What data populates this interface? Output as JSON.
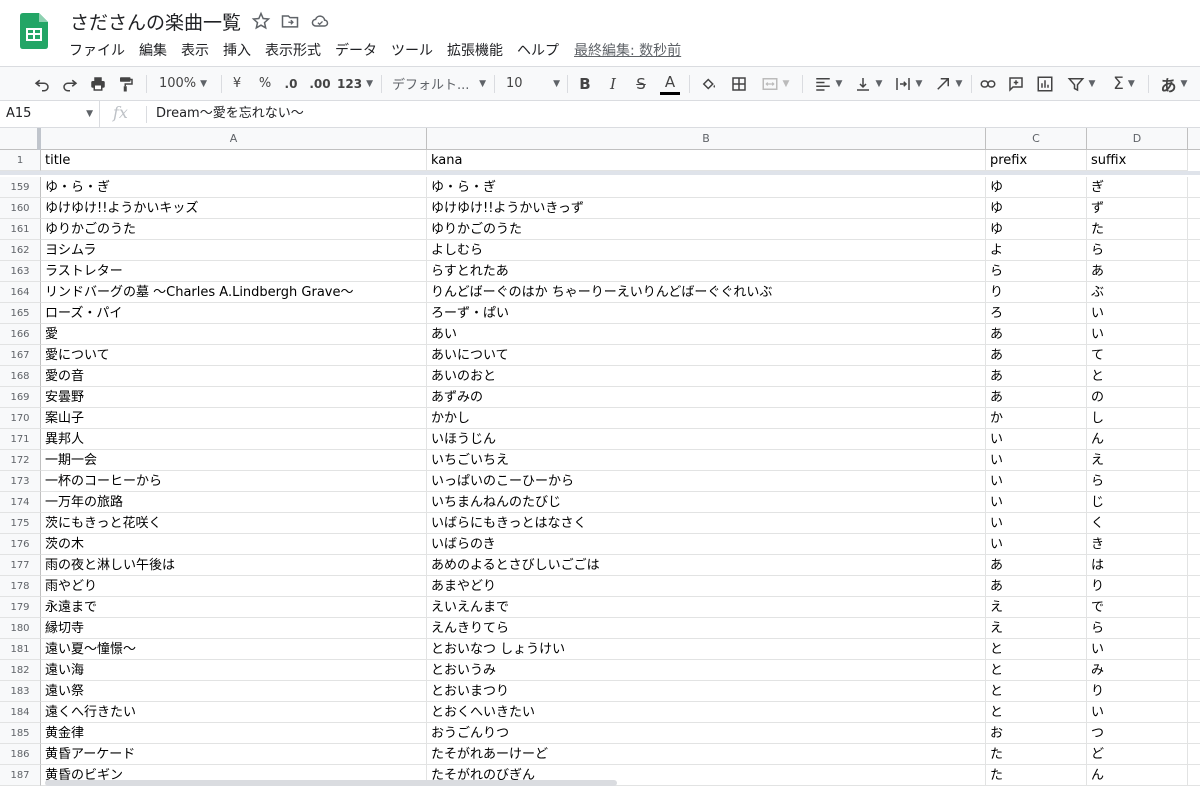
{
  "app": {
    "title": "さださんの楽曲一覧",
    "menu": [
      "ファイル",
      "編集",
      "表示",
      "挿入",
      "表示形式",
      "データ",
      "ツール",
      "拡張機能",
      "ヘルプ"
    ],
    "last_edit": "最終編集: 数秒前"
  },
  "toolbar": {
    "zoom": "100%",
    "currency": "¥",
    "percent": "%",
    "decrease_decimal": ".0",
    "increase_decimal": ".00",
    "number_format": "123",
    "font": "デフォルト...",
    "font_size": "10",
    "bold": "B",
    "italic": "I",
    "strike": "S",
    "text_color": "A",
    "input_tools": "あ"
  },
  "formula_bar": {
    "cell_ref": "A15",
    "fx": "fx",
    "value": "Dream〜愛を忘れない〜"
  },
  "columns": [
    {
      "letter": "A",
      "header": "title"
    },
    {
      "letter": "B",
      "header": "kana"
    },
    {
      "letter": "C",
      "header": "prefix"
    },
    {
      "letter": "D",
      "header": "suffix"
    }
  ],
  "header_row_number": "1",
  "rows": [
    {
      "n": "159",
      "title": "ゆ・ら・ぎ",
      "kana": "ゆ・ら・ぎ",
      "prefix": "ゆ",
      "suffix": "ぎ"
    },
    {
      "n": "160",
      "title": "ゆけゆけ!!ようかいキッズ",
      "kana": "ゆけゆけ!!ようかいきっず",
      "prefix": "ゆ",
      "suffix": "ず"
    },
    {
      "n": "161",
      "title": "ゆりかごのうた",
      "kana": "ゆりかごのうた",
      "prefix": "ゆ",
      "suffix": "た"
    },
    {
      "n": "162",
      "title": "ヨシムラ",
      "kana": "よしむら",
      "prefix": "よ",
      "suffix": "ら"
    },
    {
      "n": "163",
      "title": "ラストレター",
      "kana": "らすとれたあ",
      "prefix": "ら",
      "suffix": "あ"
    },
    {
      "n": "164",
      "title": "リンドバーグの墓 〜Charles A.Lindbergh Grave〜",
      "kana": "りんどばーぐのはか ちゃーりーえいりんどばーぐぐれいぶ",
      "prefix": "り",
      "suffix": "ぶ"
    },
    {
      "n": "165",
      "title": "ローズ・パイ",
      "kana": "ろーず・ぱい",
      "prefix": "ろ",
      "suffix": "い"
    },
    {
      "n": "166",
      "title": "愛",
      "kana": "あい",
      "prefix": "あ",
      "suffix": "い"
    },
    {
      "n": "167",
      "title": "愛について",
      "kana": "あいについて",
      "prefix": "あ",
      "suffix": "て"
    },
    {
      "n": "168",
      "title": "愛の音",
      "kana": "あいのおと",
      "prefix": "あ",
      "suffix": "と"
    },
    {
      "n": "169",
      "title": "安曇野",
      "kana": "あずみの",
      "prefix": "あ",
      "suffix": "の"
    },
    {
      "n": "170",
      "title": "案山子",
      "kana": "かかし",
      "prefix": "か",
      "suffix": "し"
    },
    {
      "n": "171",
      "title": "異邦人",
      "kana": "いほうじん",
      "prefix": "い",
      "suffix": "ん"
    },
    {
      "n": "172",
      "title": "一期一会",
      "kana": "いちごいちえ",
      "prefix": "い",
      "suffix": "え"
    },
    {
      "n": "173",
      "title": "一杯のコーヒーから",
      "kana": "いっぱいのこーひーから",
      "prefix": "い",
      "suffix": "ら"
    },
    {
      "n": "174",
      "title": "一万年の旅路",
      "kana": "いちまんねんのたびじ",
      "prefix": "い",
      "suffix": "じ"
    },
    {
      "n": "175",
      "title": "茨にもきっと花咲く",
      "kana": "いばらにもきっとはなさく",
      "prefix": "い",
      "suffix": "く"
    },
    {
      "n": "176",
      "title": "茨の木",
      "kana": "いばらのき",
      "prefix": "い",
      "suffix": "き"
    },
    {
      "n": "177",
      "title": "雨の夜と淋しい午後は",
      "kana": "あめのよるとさびしいごごは",
      "prefix": "あ",
      "suffix": "は"
    },
    {
      "n": "178",
      "title": "雨やどり",
      "kana": "あまやどり",
      "prefix": "あ",
      "suffix": "り"
    },
    {
      "n": "179",
      "title": "永遠まで",
      "kana": "えいえんまで",
      "prefix": "え",
      "suffix": "で"
    },
    {
      "n": "180",
      "title": "縁切寺",
      "kana": "えんきりてら",
      "prefix": "え",
      "suffix": "ら"
    },
    {
      "n": "181",
      "title": "遠い夏〜憧憬〜",
      "kana": "とおいなつ しょうけい",
      "prefix": "と",
      "suffix": "い"
    },
    {
      "n": "182",
      "title": "遠い海",
      "kana": "とおいうみ",
      "prefix": "と",
      "suffix": "み"
    },
    {
      "n": "183",
      "title": "遠い祭",
      "kana": "とおいまつり",
      "prefix": "と",
      "suffix": "り"
    },
    {
      "n": "184",
      "title": "遠くへ行きたい",
      "kana": "とおくへいきたい",
      "prefix": "と",
      "suffix": "い"
    },
    {
      "n": "185",
      "title": "黄金律",
      "kana": "おうごんりつ",
      "prefix": "お",
      "suffix": "つ"
    },
    {
      "n": "186",
      "title": "黄昏アーケード",
      "kana": "たそがれあーけーど",
      "prefix": "た",
      "suffix": "ど"
    },
    {
      "n": "187",
      "title": "黄昏のビギン",
      "kana": "たそがれのびぎん",
      "prefix": "た",
      "suffix": "ん"
    }
  ]
}
